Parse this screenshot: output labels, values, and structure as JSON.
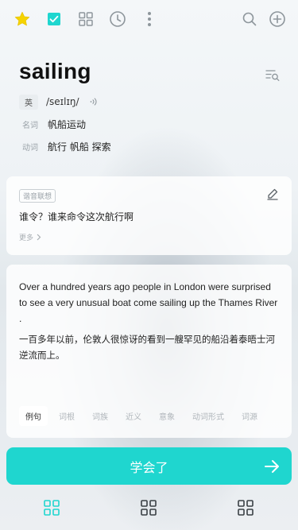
{
  "colors": {
    "accent": "#1FD6CF",
    "star": "#F5D300",
    "check_bg": "#1FD6CF",
    "icon_gray": "#8E969C"
  },
  "toolbar": {
    "icons": [
      "star-icon",
      "checkbox-icon",
      "grid-icon",
      "clock-icon",
      "more-vertical-icon",
      "search-icon",
      "add-circle-icon"
    ]
  },
  "word": {
    "headword": "sailing",
    "lang_tag": "英",
    "phonetic": "/seɪlɪŋ/",
    "definitions": [
      {
        "pos": "名词",
        "meaning": "帆船运动"
      },
      {
        "pos": "动词",
        "meaning": "航行 帆船 探索"
      }
    ]
  },
  "association": {
    "tag": "谐音联想",
    "text": "谁令？谁来命令这次航行啊",
    "more": "更多"
  },
  "example": {
    "en": "Over a hundred years ago people in London were surprised to see a very unusual boat come sailing up the Thames River .",
    "cn": "一百多年以前，伦敦人很惊讶的看到一艘罕见的船沿着泰晤士河逆流而上。"
  },
  "tabs": [
    {
      "label": "例句",
      "active": true
    },
    {
      "label": "词根",
      "active": false
    },
    {
      "label": "词族",
      "active": false
    },
    {
      "label": "近义",
      "active": false
    },
    {
      "label": "意象",
      "active": false
    },
    {
      "label": "动词形式",
      "active": false
    },
    {
      "label": "词源",
      "active": false
    }
  ],
  "learn_button": {
    "label": "学会了"
  },
  "bottom_nav": {
    "icons": [
      "grid-icon",
      "grid-icon",
      "grid-icon"
    ]
  }
}
